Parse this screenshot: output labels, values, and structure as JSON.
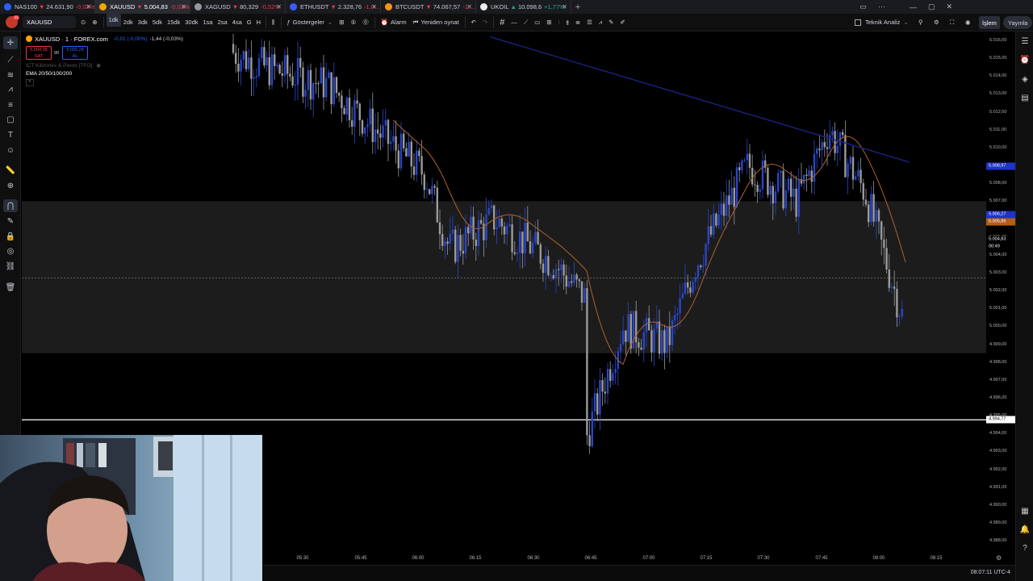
{
  "tabs": [
    {
      "symbol": "NAS100",
      "price": "24.631,90",
      "change": "-0,03%",
      "dir": "down",
      "color": "#2962ff",
      "active": false
    },
    {
      "symbol": "XAUUSD",
      "price": "5.004,83",
      "change": "-0,03%",
      "dir": "down",
      "color": "#f7a600",
      "active": true
    },
    {
      "symbol": "XAGUSD",
      "price": "80,329",
      "change": "-0,52%",
      "dir": "down",
      "color": "#9598a1",
      "active": false
    },
    {
      "symbol": "ETHUSDT",
      "price": "2.328,76",
      "change": "-1,0…",
      "dir": "down",
      "color": "#3d5afe",
      "active": false
    },
    {
      "symbol": "BTCUSDT",
      "price": "74.067,57",
      "change": "-1,…",
      "dir": "down",
      "color": "#f7931a",
      "active": false
    },
    {
      "symbol": "UKOIL",
      "price": "10.098,6",
      "change": "+1,77%",
      "dir": "up",
      "color": "#eeeeee",
      "active": false
    }
  ],
  "toolbar": {
    "symbol": "XAUUSD",
    "intervals": [
      "1dk",
      "2dk",
      "3dk",
      "5dk",
      "15dk",
      "30dk",
      "1sa",
      "2sa",
      "4sa",
      "G",
      "H"
    ],
    "active_interval": "1dk",
    "indicators_label": "Göstergeler",
    "alarm_label": "Alarm",
    "replay_label": "Yeniden oynat",
    "layout_label": "Teknik Analiz",
    "trade_label": "İşlem",
    "publish_label": "Yayınla"
  },
  "legend": {
    "title": "XAUUSD · 1 · FOREX.com",
    "change": "-0,01 (-0,00%)",
    "change2": "-1,44 (-0,03%)",
    "sell_price": "5.004,38",
    "sell_label": "SAT",
    "spread": "90",
    "buy_price": "5.005,28",
    "buy_label": "AL",
    "indicator1": "ICT Killzones & Pivots [TFO]",
    "indicator2": "EMA 20/50/100/200"
  },
  "price_scale": {
    "ticks": [
      "5.016,00",
      "5.015,00",
      "5.014,00",
      "5.013,00",
      "5.012,00",
      "5.011,00",
      "5.010,00",
      "5.009,00",
      "5.008,00",
      "5.007,00",
      "5.006,00",
      "5.005,00",
      "5.004,00",
      "5.003,00",
      "5.002,00",
      "5.001,00",
      "5.000,00",
      "4.999,00",
      "4.998,00",
      "4.997,00",
      "4.996,00",
      "4.995,00",
      "4.994,00",
      "4.993,00",
      "4.992,00",
      "4.991,00",
      "4.990,00",
      "4.989,00",
      "4.988,00"
    ],
    "label_ema_blue": "5.008,97",
    "label_ema_orange1": "5.006,27",
    "label_ema_orange2": "5.005,86",
    "label_price": "5.004,83",
    "label_countdown": "00:49",
    "label_hline": "4.994,77"
  },
  "time_scale": [
    "05:30",
    "05:45",
    "06:00",
    "06:15",
    "06:30",
    "06:45",
    "07:00",
    "07:15",
    "07:30",
    "07:45",
    "08:00",
    "08:15"
  ],
  "clock": "08:07:11 UTC-4",
  "colors": {
    "up": "#2b46c8",
    "down": "#9a9a9a",
    "zone": "#1c1c1c",
    "ema_orange": "#b0622a",
    "ema_blue": "#1a237e",
    "tab_up": "#22ab94",
    "tab_down": "#f23645"
  },
  "chart_data": {
    "type": "candlestick",
    "instrument": "XAUUSD",
    "timeframe": "1",
    "x": [
      "05:30",
      "05:45",
      "06:00",
      "06:15",
      "06:30",
      "06:45",
      "07:00",
      "07:15",
      "07:30",
      "07:45",
      "08:00"
    ],
    "close_path": [
      5015.8,
      5014.5,
      5013.5,
      5010.5,
      5008.5,
      5004.3,
      5006.0,
      5003.5,
      5001.5,
      4992.5,
      5000.0,
      4999.0,
      5003.5,
      5006.5,
      5009.0,
      5007.0,
      5011.0,
      5007.5,
      5000.0,
      5004.83
    ],
    "ylim": [
      4987.5,
      5016.5
    ],
    "zone_range": [
      4998.5,
      5007.0
    ],
    "horizontal_line": 4994.77,
    "dashed_line": 5002.7
  }
}
